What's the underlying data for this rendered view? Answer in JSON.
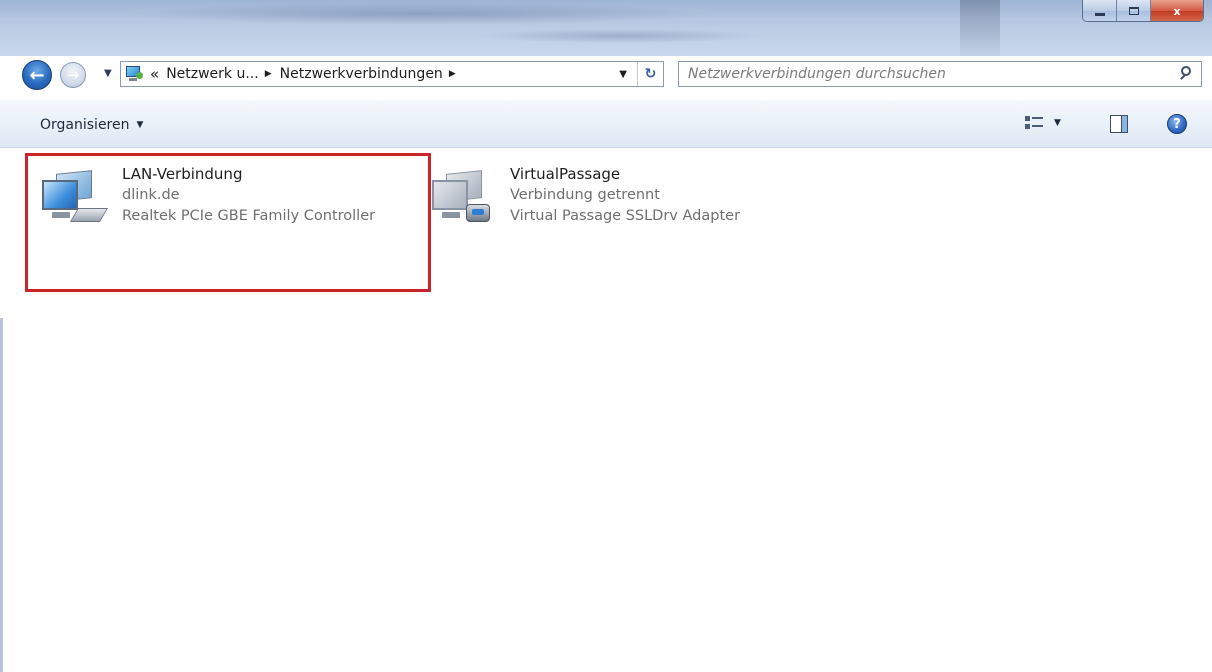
{
  "window": {
    "minimize_label": "",
    "maximize_label": "",
    "close_label": "x"
  },
  "nav": {
    "back_glyph": "←",
    "forward_glyph": "→",
    "breadcrumb_overflow": "«",
    "breadcrumbs": [
      "Netzwerk u...",
      "Netzwerkverbindungen"
    ],
    "crumb_sep": "▶",
    "refresh_glyph": "↻"
  },
  "search": {
    "placeholder": "Netzwerkverbindungen durchsuchen"
  },
  "toolbar": {
    "organize_label": "Organisieren",
    "help_glyph": "?"
  },
  "connections": [
    {
      "name": "LAN-Verbindung",
      "status": "dlink.de",
      "device": "Realtek PCIe GBE Family Controller",
      "icon": "lan-adapter-icon",
      "selected": true
    },
    {
      "name": "VirtualPassage",
      "status": "Verbindung getrennt",
      "device": "Virtual Passage SSLDrv Adapter",
      "icon": "vpn-adapter-icon",
      "selected": false
    }
  ],
  "colors": {
    "selection_border": "#c9242c",
    "toolbar_bg": "#e9f0f8",
    "secondary_text": "#6f6f6f"
  }
}
